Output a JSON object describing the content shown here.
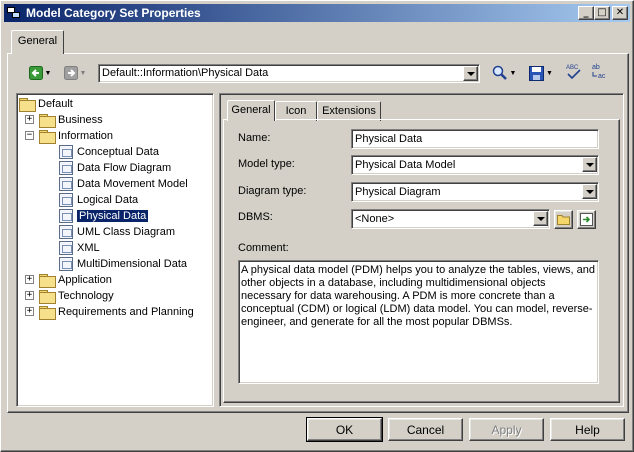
{
  "window": {
    "title": "Model Category Set Properties",
    "caption_minimize": "_",
    "caption_maximize": "□",
    "caption_close": "✕"
  },
  "outer_tab": "General",
  "toolbar": {
    "back_icon": "back-arrow-icon",
    "forward_icon": "forward-arrow-icon",
    "path": "Default::Information\\Physical Data",
    "find_icon": "magnifier-icon",
    "save_icon": "floppy-disk-icon",
    "spell_icon": "spell-check-icon",
    "replace_icon": "replace-text-icon"
  },
  "tree": {
    "root": "Default",
    "nodes": [
      {
        "label": "Business",
        "expander": "+"
      },
      {
        "label": "Information",
        "expander": "−"
      },
      {
        "label": "Conceptual Data"
      },
      {
        "label": "Data Flow Diagram"
      },
      {
        "label": "Data Movement Model"
      },
      {
        "label": "Logical Data"
      },
      {
        "label": "Physical Data"
      },
      {
        "label": "UML Class Diagram"
      },
      {
        "label": "XML"
      },
      {
        "label": "MultiDimensional Data"
      },
      {
        "label": "Application",
        "expander": "+"
      },
      {
        "label": "Technology",
        "expander": "+"
      },
      {
        "label": "Requirements and Planning",
        "expander": "+"
      }
    ],
    "selected": "Physical Data"
  },
  "inner_tabs": [
    "General",
    "Icon",
    "Extensions"
  ],
  "form": {
    "name_label": "Name:",
    "name_value": "Physical Data",
    "model_type_label": "Model type:",
    "model_type_value": "Physical Data Model",
    "diagram_type_label": "Diagram type:",
    "diagram_type_value": "Physical Diagram",
    "dbms_label": "DBMS:",
    "dbms_value": "<None>",
    "comment_label": "Comment:",
    "comment_value": "A physical data model (PDM) helps you to analyze the tables, views, and other objects in a database, including multidimensional objects necessary for data warehousing. A PDM is more concrete than a conceptual (CDM) or logical (LDM) data model. You can model, reverse-engineer, and generate for all the most popular DBMSs."
  },
  "buttons": {
    "ok": "OK",
    "cancel": "Cancel",
    "apply": "Apply",
    "help": "Help"
  },
  "colors": {
    "title_bar": "#0a246a",
    "selection": "#0a246a",
    "face": "#d4d0c8"
  }
}
